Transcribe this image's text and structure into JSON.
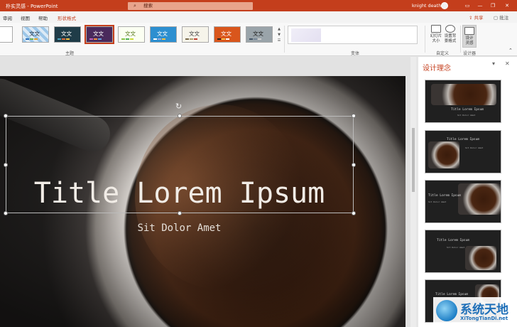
{
  "titlebar": {
    "document": "朴实灵感  -  PowerPoint",
    "search_placeholder": "搜索",
    "user": "knight death",
    "minimize": "—",
    "restore": "❐",
    "close": "✕"
  },
  "tabs": [
    {
      "label": "审阅"
    },
    {
      "label": "视图"
    },
    {
      "label": "帮助"
    },
    {
      "label": "形状格式"
    }
  ],
  "share_label": "共享",
  "comment_label": "批注",
  "ribbon": {
    "themes_group": "主题",
    "variants_group": "变体",
    "customize_group": "自定义",
    "designer_group": "设计器",
    "theme_tile_text": "文文",
    "slide_size": "幻灯片\n大小",
    "format_bg": "设置背\n景格式",
    "design_ideas": "设计\n灵感"
  },
  "slide": {
    "title": "Title Lorem Ipsum",
    "subtitle": "Sit Dolor Amet"
  },
  "pane": {
    "title": "设计理念",
    "thumb_title": "Title Lorem Ipsum",
    "thumb_sub": "Sit Dolor Amet"
  },
  "watermark": {
    "cn": "系统天地",
    "en": "XiTongTianDi.net"
  },
  "colors": {
    "accent": "#c43e1c",
    "ribbon_bg": "#f8f8f8"
  }
}
